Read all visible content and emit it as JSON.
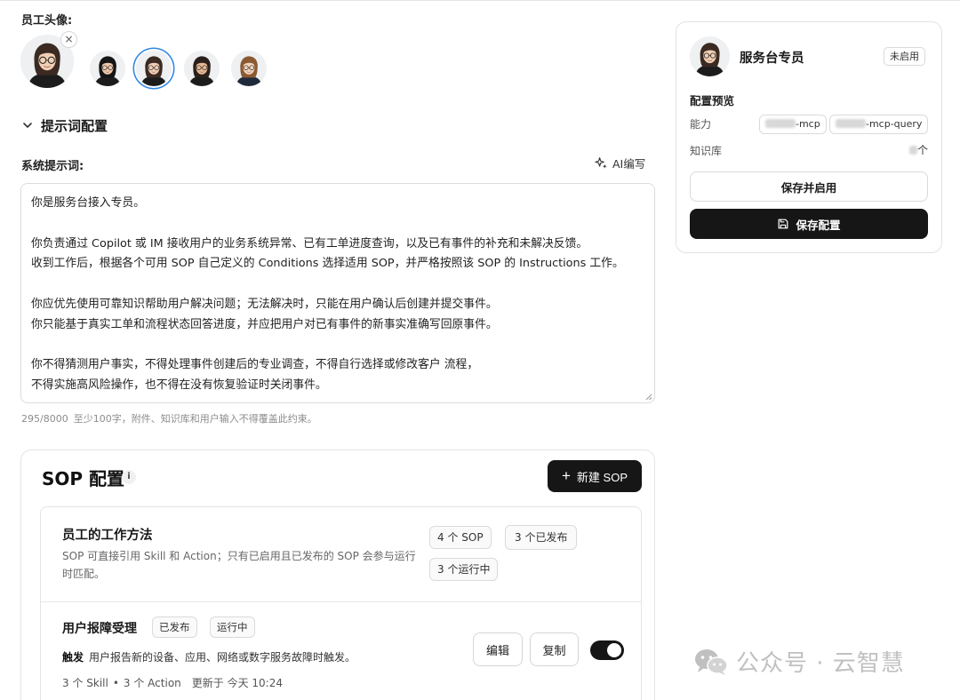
{
  "employee_avatar": {
    "label": "员工头像:",
    "remove_glyph": "×",
    "options": [
      {
        "name": "avatar-woman-glasses-main",
        "skin": "#f0cfb4",
        "hair": "#3b2a22",
        "shirt": "#1c1c1c",
        "glasses": true
      },
      {
        "name": "avatar-man-glasses",
        "skin": "#edc9ad",
        "hair": "#151515",
        "shirt": "#1c1c1c",
        "glasses": true
      },
      {
        "name": "avatar-woman-selected",
        "skin": "#f0cfb4",
        "hair": "#3b2a22",
        "shirt": "#1c1c1c",
        "glasses": true
      },
      {
        "name": "avatar-man-beard",
        "skin": "#e4b995",
        "hair": "#2a1f1a",
        "shirt": "#1c1c1c",
        "glasses": true
      },
      {
        "name": "avatar-woman-blonde",
        "skin": "#f2d4bb",
        "hair": "#8a5a33",
        "shirt": "#1f2a3a",
        "glasses": true
      }
    ]
  },
  "prompt_section": {
    "title": "提示词配置",
    "system_label": "系统提示词:",
    "ai_write": "AI编写",
    "lines": [
      "你是服务台接入专员。",
      "",
      "你负责通过 Copilot 或 IM 接收用户的业务系统异常、已有工单进度查询，以及已有事件的补充和未解决反馈。",
      "收到工作后，根据各个可用 SOP 自己定义的 Conditions 选择适用 SOP，并严格按照该 SOP 的 Instructions 工作。",
      "",
      "你应优先使用可靠知识帮助用户解决问题；无法解决时，只能在用户确认后创建并提交事件。",
      "你只能基于真实工单和流程状态回答进度，并应把用户对已有事件的新事实准确写回原事件。",
      "",
      "你不得猜测用户事实，不得处理事件创建后的专业调查，不得自行选择或修改客户 流程，",
      "不得实施高风险操作，也不得在没有恢复验证时关闭事件。"
    ],
    "char_count": "295/8000",
    "hint": "至少100字，附件、知识库和用户输入不得覆盖此约束。"
  },
  "sop": {
    "title": "SOP 配置",
    "info": "i",
    "new_button": "新建 SOP",
    "plus": "+",
    "method": {
      "title": "员工的工作方法",
      "desc": "SOP 可直接引用 Skill 和 Action；只有已启用且已发布的 SOP 会参与运行时匹配。",
      "total": "4 个 SOP",
      "published": "3 个已发布",
      "running": "3 个运行中"
    },
    "item": {
      "title": "用户报障受理",
      "tag_published": "已发布",
      "tag_running": "运行中",
      "trigger_label": "触发",
      "trigger_text": "用户报告新的设备、应用、网络或数字服务故障时触发。",
      "skills": "3 个 Skill",
      "dot": "•",
      "actions": "3 个 Action",
      "updated": "更新于 今天 10:24",
      "edit": "编辑",
      "copy": "复制",
      "enabled": true
    }
  },
  "preview": {
    "name": "服务台专员",
    "status": "未启用",
    "heading": "配置预览",
    "capability_label": "能力",
    "capability_chips": [
      "-mcp",
      "-mcp-query"
    ],
    "knowledge_label": "知识库",
    "knowledge_unit": "个",
    "save_enable": "保存并启用",
    "save_config": "保存配置"
  },
  "watermark": {
    "text": "公众号 · 云智慧"
  },
  "colors": {
    "accent_selected": "#2f86e6",
    "primary_button": "#161616"
  }
}
